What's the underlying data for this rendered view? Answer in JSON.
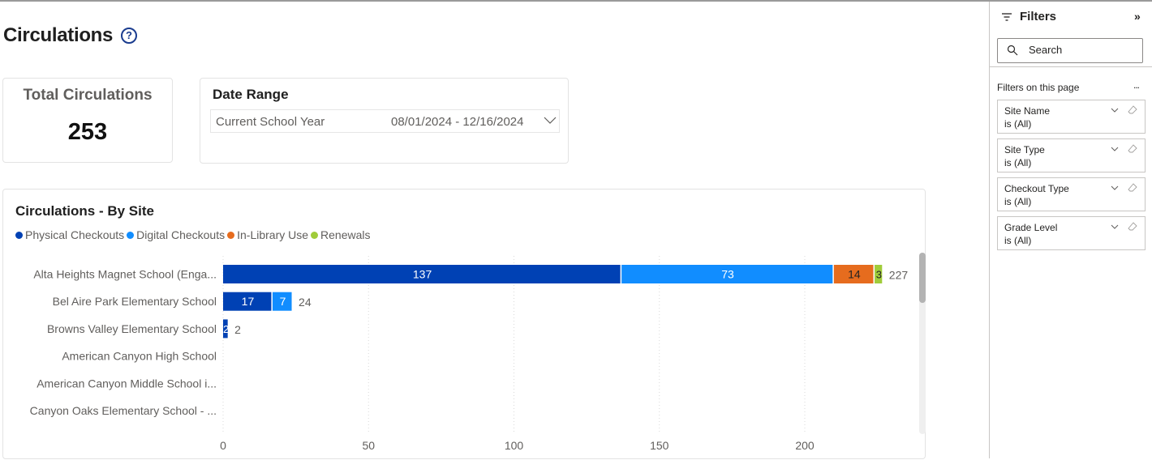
{
  "page": {
    "title": "Circulations"
  },
  "kpi": {
    "title": "Total Circulations",
    "value": "253"
  },
  "date_range": {
    "title": "Date Range",
    "preset": "Current School Year",
    "range": "08/01/2024 - 12/16/2024"
  },
  "filters_pane": {
    "title": "Filters",
    "search_placeholder": "Search",
    "section_label": "Filters on this page",
    "more_label": "...",
    "filters": [
      {
        "name": "Site Name",
        "value": "is (All)"
      },
      {
        "name": "Site Type",
        "value": "is (All)"
      },
      {
        "name": "Checkout Type",
        "value": "is (All)"
      },
      {
        "name": "Grade Level",
        "value": "is (All)"
      }
    ]
  },
  "colors": {
    "physical": "#0041b4",
    "digital": "#118dff",
    "in_library": "#e66c1e",
    "renewals": "#a0cc3a"
  },
  "chart_data": {
    "type": "bar",
    "orientation": "horizontal",
    "stacked": true,
    "title": "Circulations - By Site",
    "xlabel": "",
    "ylabel": "",
    "xlim": [
      0,
      237
    ],
    "x_ticks": [
      0,
      50,
      100,
      150,
      200
    ],
    "grid": true,
    "legend_position": "top-left",
    "categories": [
      "Alta Heights Magnet School (Enga...",
      "Bel Aire Park Elementary School",
      "Browns Valley Elementary School",
      "American Canyon High School",
      "American Canyon Middle School i...",
      "Canyon Oaks Elementary School - ..."
    ],
    "series": [
      {
        "name": "Physical Checkouts",
        "color": "#0041b4",
        "label_color": "#ffffff",
        "values": [
          137,
          17,
          2,
          0,
          0,
          0
        ]
      },
      {
        "name": "Digital Checkouts",
        "color": "#118dff",
        "label_color": "#ffffff",
        "values": [
          73,
          7,
          0,
          0,
          0,
          0
        ]
      },
      {
        "name": "In-Library Use",
        "color": "#e66c1e",
        "label_color": "#252423",
        "values": [
          14,
          0,
          0,
          0,
          0,
          0
        ]
      },
      {
        "name": "Renewals",
        "color": "#a0cc3a",
        "label_color": "#252423",
        "values": [
          3,
          0,
          0,
          0,
          0,
          0
        ]
      }
    ],
    "totals": [
      227,
      24,
      2,
      null,
      null,
      null
    ]
  }
}
